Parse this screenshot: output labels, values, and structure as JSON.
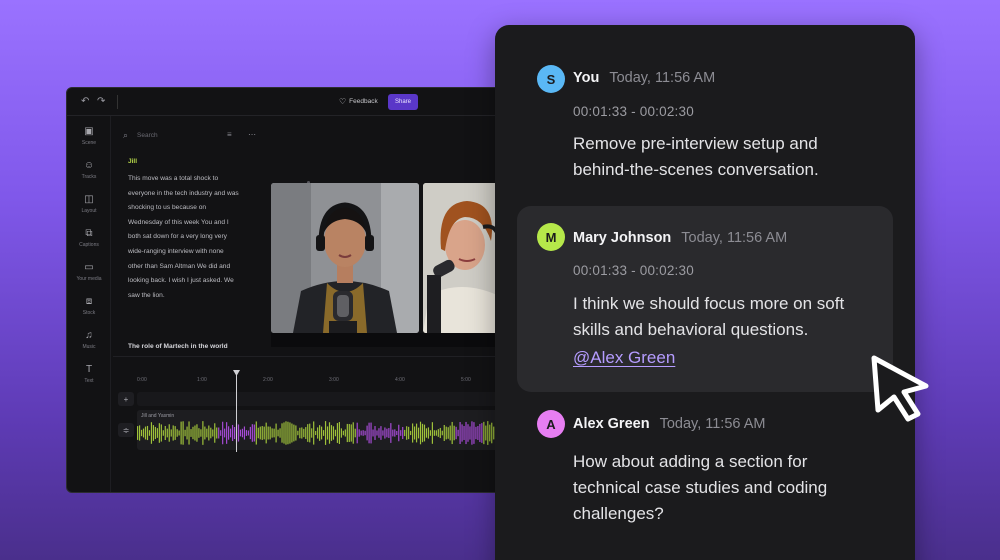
{
  "editor": {
    "toolbar": {
      "undo_icon": "undo-icon",
      "redo_icon": "redo-icon",
      "feedback_label": "Feedback",
      "share_label": "Share"
    },
    "sidebar": [
      {
        "icon": "scene-icon",
        "glyph": "▣",
        "label": "Scene"
      },
      {
        "icon": "tracks-icon",
        "glyph": "☺",
        "label": "Tracks"
      },
      {
        "icon": "layout-icon",
        "glyph": "◫",
        "label": "Layout"
      },
      {
        "icon": "captions-icon",
        "glyph": "⧉",
        "label": "Captions"
      },
      {
        "icon": "folder-icon",
        "glyph": "▭",
        "label": "Your media"
      },
      {
        "icon": "stock-icon",
        "glyph": "⧈",
        "label": "Stock"
      },
      {
        "icon": "music-icon",
        "glyph": "♫",
        "label": "Music"
      },
      {
        "icon": "text-icon",
        "glyph": "T",
        "label": "Text"
      }
    ],
    "transcript": {
      "search_placeholder": "Search",
      "speaker": "Jill",
      "paragraph": "This move was a total shock to everyone in the tech industry and was shocking to us because on Wednesday of this week You and I both sat down for a very long very wide-ranging interview with none other than Sam Altman We did and looking back. I wish I just asked. We saw the lion.",
      "heading": "The role of Martech in the world"
    },
    "timeline": {
      "ticks": [
        "0:00",
        "1:00",
        "2:00",
        "3:00",
        "4:00",
        "5:00"
      ],
      "track_label": "Jill and Yasmin"
    }
  },
  "comments": [
    {
      "initial": "S",
      "avatar_color": "#5ab8f5",
      "author": "You",
      "time": "Today, 11:56 AM",
      "range": "00:01:33 - 00:02:30",
      "text": "Remove pre-interview setup and behind-the-scenes conversation."
    },
    {
      "initial": "M",
      "avatar_color": "#b6e84a",
      "author": "Mary Johnson",
      "time": "Today, 11:56 AM",
      "range": "00:01:33 - 00:02:30",
      "text": "I think we should focus more on soft skills and behavioral questions.",
      "mention": "@Alex Green"
    },
    {
      "initial": "A",
      "avatar_color": "#e77ef2",
      "author": "Alex Green",
      "time": "Today, 11:56 AM",
      "text": "How about adding a section for technical case studies and coding challenges?"
    }
  ],
  "colors": {
    "accent": "#5a37c8",
    "mention": "#b59cff",
    "wave_green": "#9fc23a",
    "wave_purple": "#a64bd6"
  }
}
